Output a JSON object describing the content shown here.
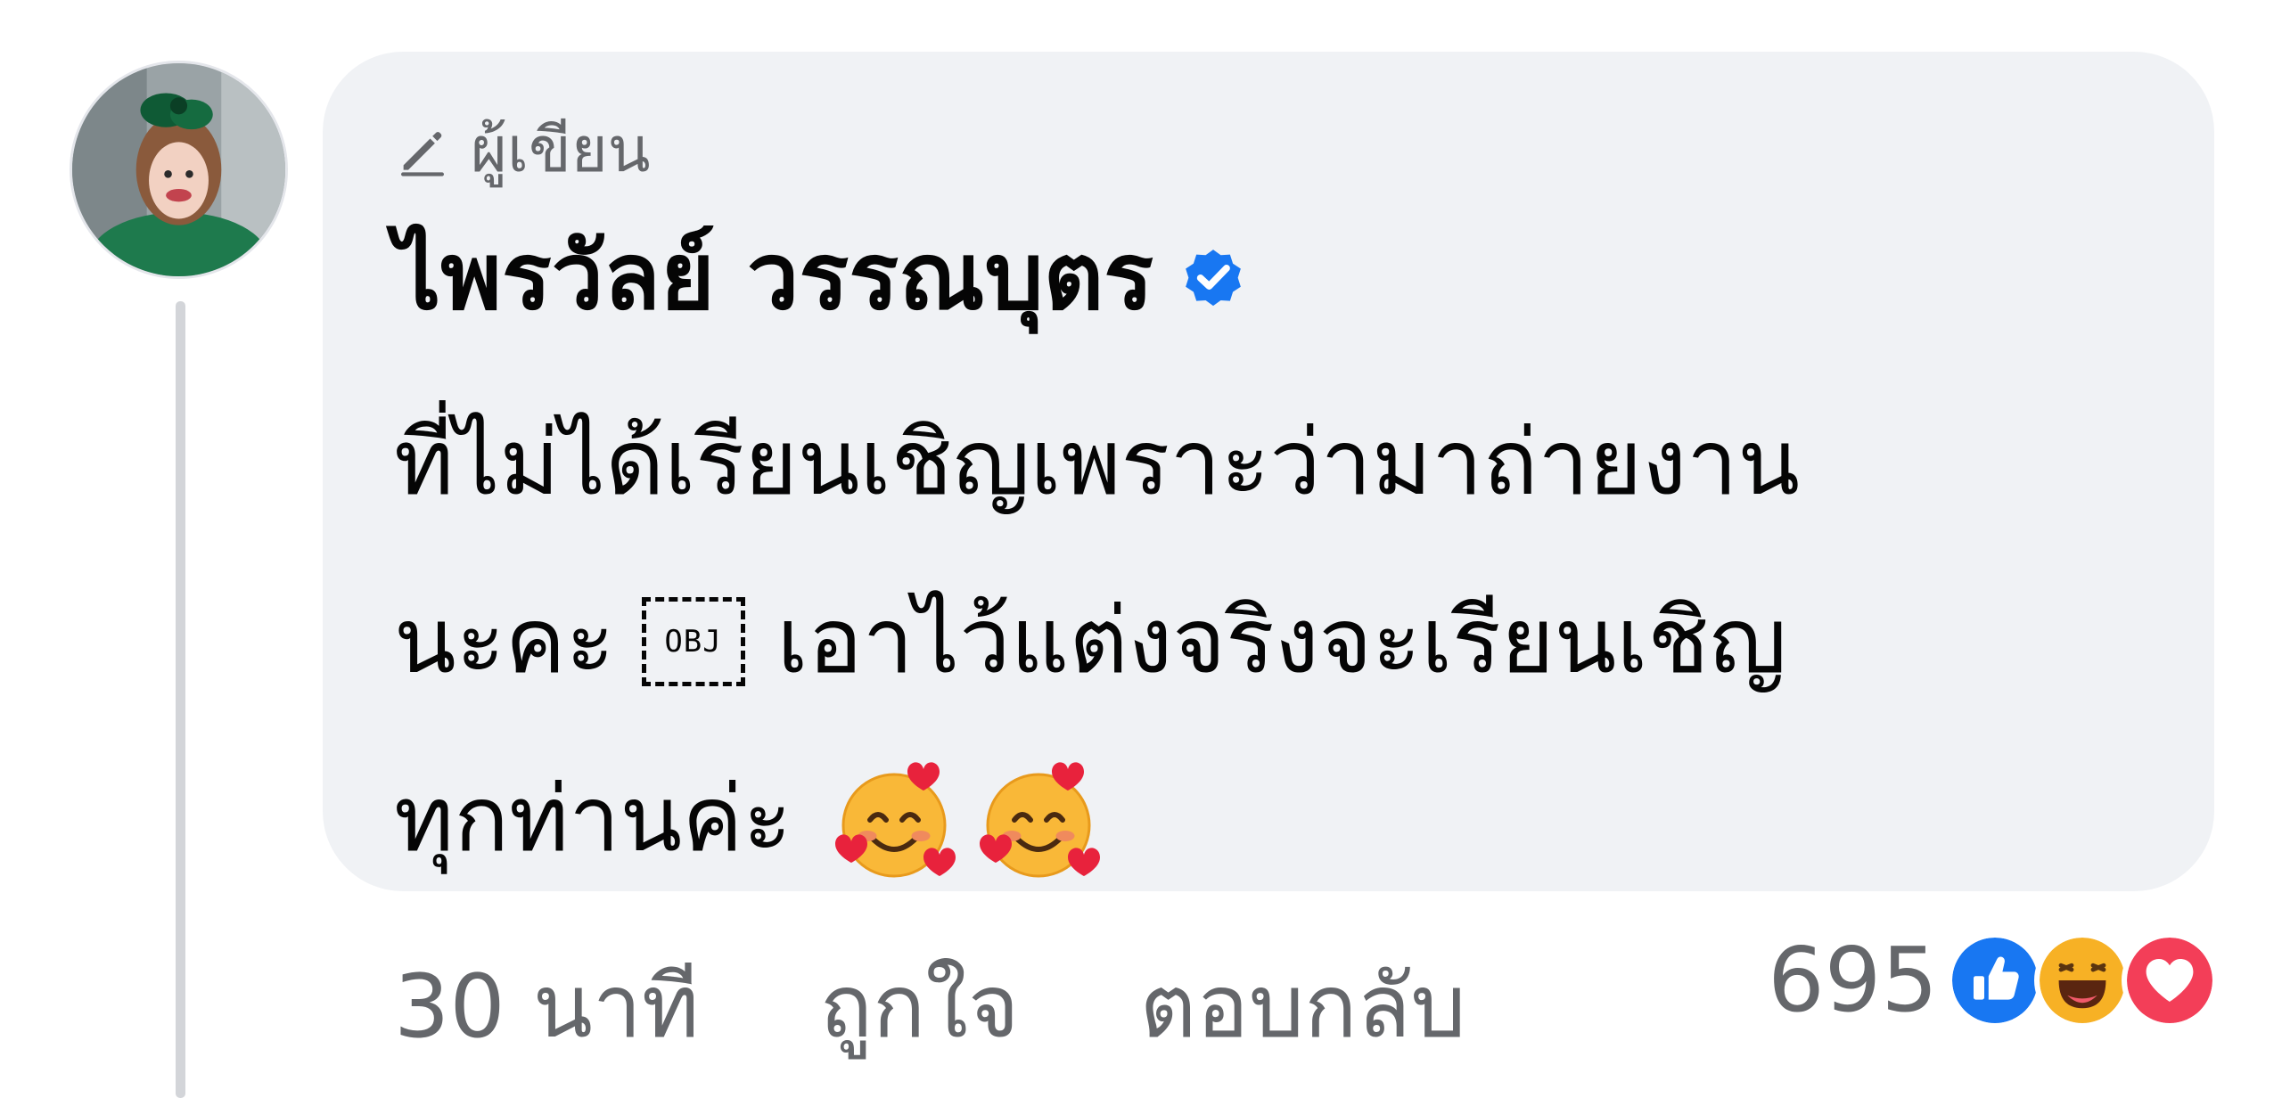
{
  "comment": {
    "author_badge_label": "ผู้เขียน",
    "author_badge_icon": "pencil-icon",
    "commenter_name": "ไพรวัลย์ วรรณบุตร",
    "verified_icon": "verified-badge-icon",
    "verified_color": "#1877f2",
    "text_lines": [
      "ที่ไม่ได้เรียนเชิญเพราะว่ามาถ่ายงาน",
      "นะคะ",
      "เอาไว้แต่งจริงจะเรียนเชิญ",
      "ทุกท่านค่ะ"
    ],
    "object_placeholder": "OBJ",
    "emojis": [
      "smiling-face-with-hearts-emoji",
      "smiling-face-with-hearts-emoji"
    ]
  },
  "actions": {
    "timestamp": "30 นาที",
    "like_label": "ถูกใจ",
    "reply_label": "ตอบกลับ"
  },
  "reactions": {
    "count": "695",
    "icons": [
      "like-reaction-icon",
      "haha-reaction-icon",
      "love-reaction-icon"
    ],
    "colors": {
      "like": "#1877f2",
      "haha": "#f7b125",
      "love": "#f33e58"
    }
  },
  "colors": {
    "bubble_background": "#f0f2f5",
    "secondary_text": "#65676b",
    "primary_text": "#050505",
    "thread_line": "#d3d5d9"
  }
}
